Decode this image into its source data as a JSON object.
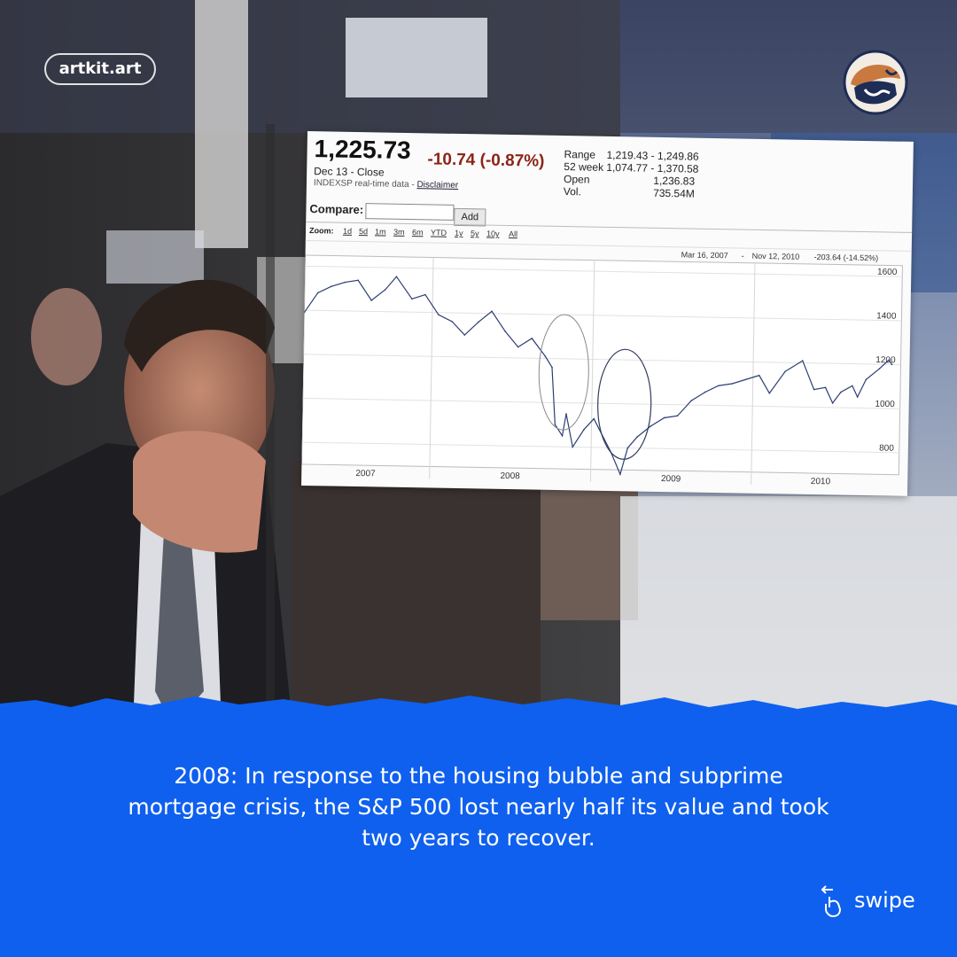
{
  "brand": {
    "name": "artkit.art"
  },
  "quote": {
    "price": "1,225.73",
    "change": "-10.74",
    "change_pct": "(-0.87%)",
    "date": "Dec 13 - Close",
    "source": "INDEXSP real-time data - ",
    "disclaimer": "Disclaimer",
    "stats": [
      {
        "label": "Range",
        "value": "1,219.43 - 1,249.86"
      },
      {
        "label": "52 week",
        "value": "1,074.77 - 1,370.58"
      },
      {
        "label": "Open",
        "value": "1,236.83"
      },
      {
        "label": "Vol.",
        "value": "735.54M"
      }
    ]
  },
  "compare": {
    "label": "Compare:",
    "value": "",
    "button": "Add"
  },
  "zoom": {
    "label": "Zoom:",
    "options": [
      "1d",
      "5d",
      "1m",
      "3m",
      "6m",
      "YTD",
      "1y",
      "5y",
      "10y",
      "All"
    ]
  },
  "range_info": {
    "start": "Mar 16, 2007",
    "sep": "-",
    "end": "Nov 12, 2010",
    "change": "-203.64 (-14.52%)"
  },
  "caption": "2008: In response to the housing bubble and subprime mortgage crisis, the S&P 500 lost nearly half its value and took two years to recover.",
  "swipe": {
    "label": "swipe",
    "icon": "hand-swipe-icon"
  },
  "colors": {
    "blue_band": "#0f60ee",
    "price_change": "#8a2416",
    "line": "#2c3e73"
  },
  "chart_data": {
    "type": "line",
    "title": "",
    "xlabel": "",
    "ylabel": "",
    "x_tick_labels": [
      "2007",
      "2008",
      "2009",
      "2010"
    ],
    "y_tick_labels": [
      "1600",
      "1400",
      "1200",
      "1000",
      "800"
    ],
    "ylim": [
      700,
      1650
    ],
    "xlim": [
      "2007-03-16",
      "2010-11-12"
    ],
    "series": [
      {
        "x": [
          "2007-03-16",
          "2007-04-15",
          "2007-05-15",
          "2007-06-15",
          "2007-07-15",
          "2007-08-15",
          "2007-09-15",
          "2007-10-10",
          "2007-11-15",
          "2007-12-15",
          "2008-01-15",
          "2008-02-15",
          "2008-03-15",
          "2008-04-15",
          "2008-05-15",
          "2008-06-15",
          "2008-07-15",
          "2008-08-15",
          "2008-09-15",
          "2008-10-01",
          "2008-10-10",
          "2008-10-27",
          "2008-11-04",
          "2008-11-20",
          "2008-12-15",
          "2009-01-06",
          "2009-02-15",
          "2009-03-09",
          "2009-03-25",
          "2009-04-15",
          "2009-05-15",
          "2009-06-15",
          "2009-07-15",
          "2009-08-15",
          "2009-09-15",
          "2009-10-15",
          "2009-11-15",
          "2009-12-15",
          "2010-01-15",
          "2010-02-08",
          "2010-03-15",
          "2010-04-23",
          "2010-05-20",
          "2010-06-15",
          "2010-07-02",
          "2010-07-20",
          "2010-08-15",
          "2010-08-27",
          "2010-09-15",
          "2010-10-15",
          "2010-11-05",
          "2010-11-12"
        ],
        "values": [
          1390,
          1480,
          1510,
          1530,
          1540,
          1450,
          1500,
          1560,
          1460,
          1480,
          1390,
          1360,
          1300,
          1360,
          1410,
          1320,
          1250,
          1290,
          1210,
          1160,
          900,
          850,
          950,
          800,
          880,
          930,
          780,
          680,
          800,
          850,
          900,
          940,
          950,
          1020,
          1060,
          1090,
          1100,
          1120,
          1140,
          1060,
          1160,
          1210,
          1080,
          1090,
          1020,
          1070,
          1100,
          1050,
          1130,
          1180,
          1220,
          1200
        ]
      }
    ],
    "annotations": [
      "ellipse-2008-crash",
      "ellipse-2009-bottom"
    ]
  }
}
